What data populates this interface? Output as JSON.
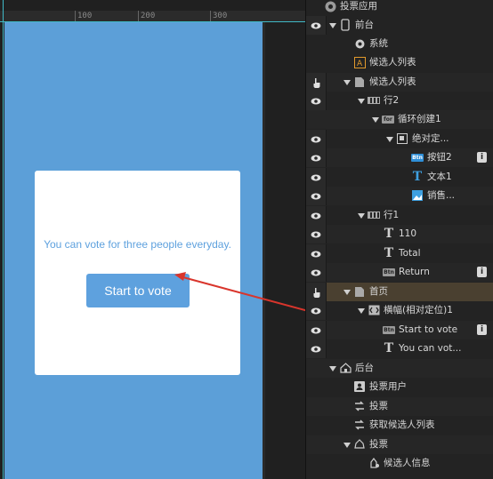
{
  "ruler": {
    "ticks": [
      "100",
      "200",
      "300"
    ]
  },
  "canvas": {
    "phone_bg": "#5c9fd8",
    "card_text": "You can vote for three people everyday.",
    "button_label": "Start to vote"
  },
  "panel": {
    "top_label": "投票应用",
    "rows": [
      {
        "label": "前台"
      },
      {
        "label": "系统"
      },
      {
        "label": "候选人列表"
      },
      {
        "label": "候选人列表"
      },
      {
        "label": "行2"
      },
      {
        "label": "循环创建1"
      },
      {
        "label": "绝对定..."
      },
      {
        "label": "按钮2"
      },
      {
        "label": "文本1"
      },
      {
        "label": "销售..."
      },
      {
        "label": "行1"
      },
      {
        "label": "110"
      },
      {
        "label": "Total"
      },
      {
        "label": "Return"
      },
      {
        "label": "首页"
      },
      {
        "label": "横幅(相对定位)1"
      },
      {
        "label": "Start to vote"
      },
      {
        "label": "You can vot..."
      },
      {
        "label": "后台"
      },
      {
        "label": "投票用户"
      },
      {
        "label": "投票"
      },
      {
        "label": "获取候选人列表"
      },
      {
        "label": "投票"
      },
      {
        "label": "候选人信息"
      }
    ]
  },
  "colors": {
    "accent": "#5ea1de",
    "arrow": "#d9352c",
    "guide": "#3fb9c7"
  }
}
